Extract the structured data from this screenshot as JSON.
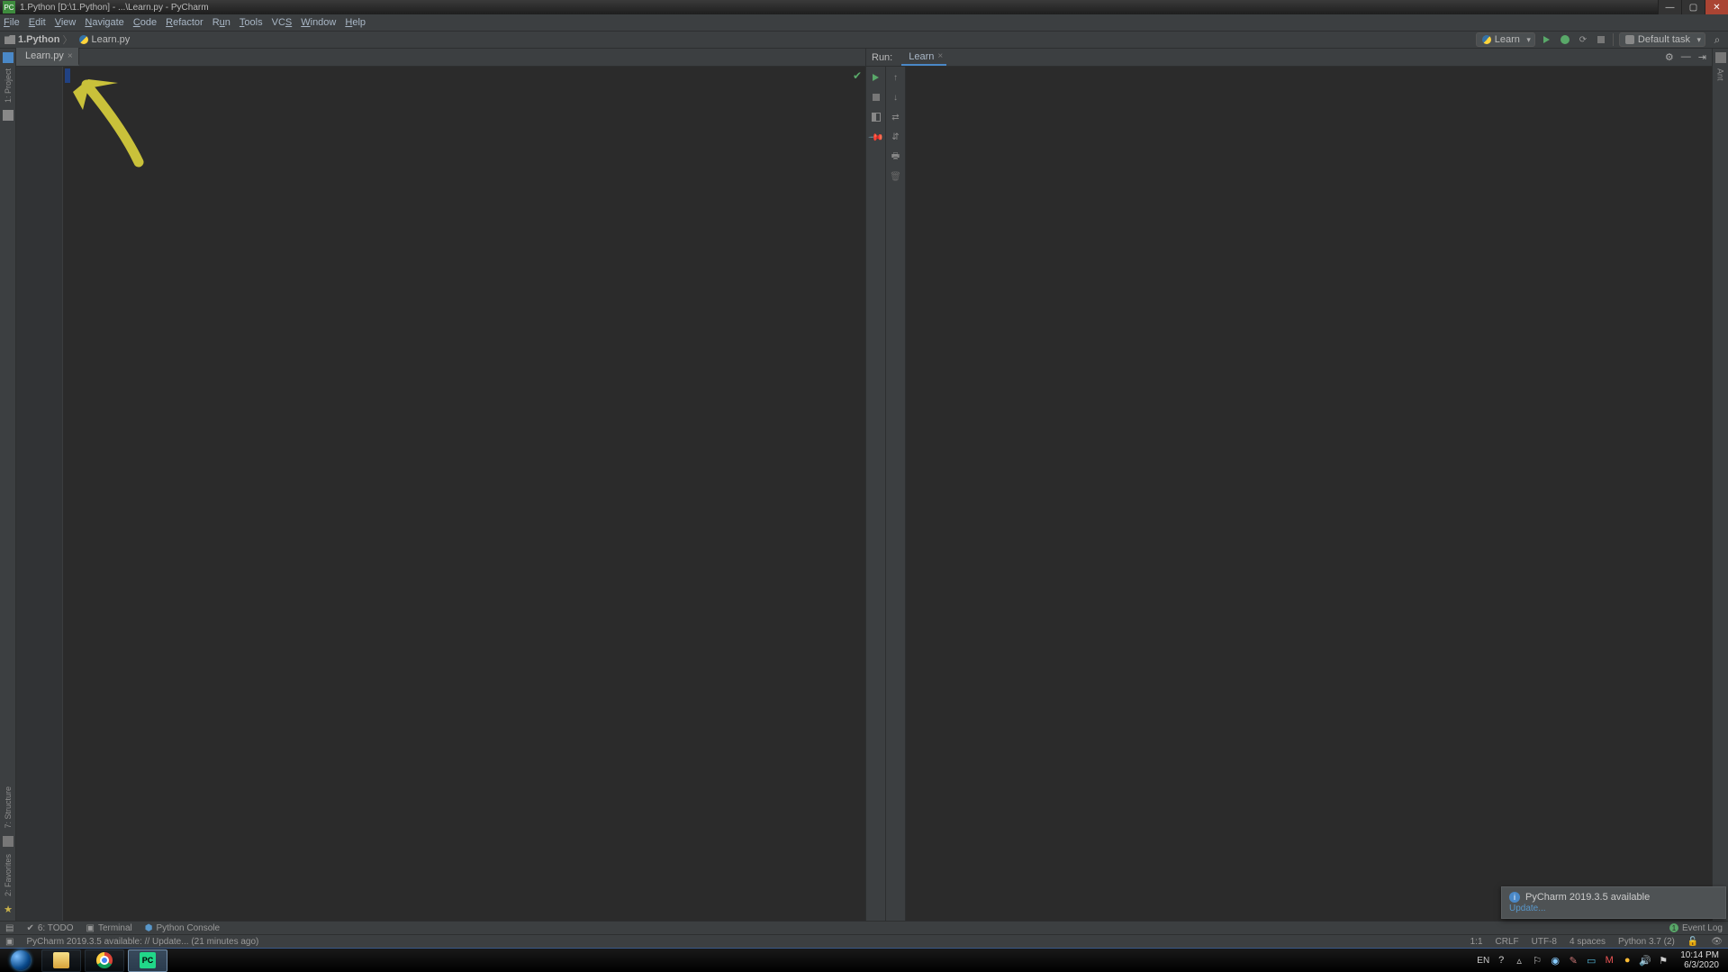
{
  "titlebar": {
    "text": "1.Python [D:\\1.Python] - ...\\Learn.py - PyCharm"
  },
  "menubar": [
    "File",
    "Edit",
    "View",
    "Navigate",
    "Code",
    "Refactor",
    "Run",
    "Tools",
    "VCS",
    "Window",
    "Help"
  ],
  "breadcrumbs": {
    "project": "1.Python",
    "file": "Learn.py"
  },
  "toolbar_right": {
    "run_config": "Learn",
    "task": "Default task"
  },
  "editor": {
    "tab": "Learn.py"
  },
  "run_panel": {
    "title": "Run:",
    "tab": "Learn"
  },
  "left_tool_top": {
    "project": "1: Project"
  },
  "left_tool_bottom": {
    "structure": "7: Structure",
    "favorites": "2: Favorites"
  },
  "right_tool": {
    "ant": "Ant"
  },
  "notification": {
    "title": "PyCharm 2019.3.5 available",
    "link": "Update..."
  },
  "bottom_tools": {
    "todo": "6: TODO",
    "terminal": "Terminal",
    "pyconsole": "Python Console",
    "eventlog": "Event Log"
  },
  "status": {
    "left": "PyCharm 2019.3.5 available: // Update... (21 minutes ago)",
    "pos": "1:1",
    "eol": "CRLF",
    "enc": "UTF-8",
    "indent": "4 spaces",
    "sdk": "Python 3.7 (2)"
  },
  "taskbar": {
    "lang": "EN",
    "time": "10:14 PM",
    "date": "6/3/2020"
  }
}
